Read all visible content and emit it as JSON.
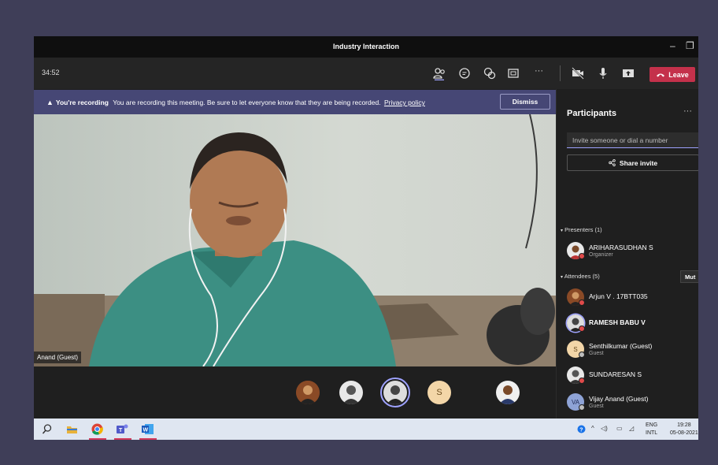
{
  "window": {
    "title": "Industry Interaction",
    "minimize": "–",
    "restore": "❐"
  },
  "toolbar": {
    "timer": "34:52",
    "leave_label": "Leave",
    "more": "···"
  },
  "banner": {
    "bold": "You're recording",
    "message": "You are recording this meeting. Be sure to let everyone know that they are being recorded.",
    "link": "Privacy policy",
    "dismiss": "Dismiss"
  },
  "video": {
    "name_tag": "Anand (Guest)"
  },
  "strip": {
    "letter_avatar": "S"
  },
  "participants": {
    "title": "Participants",
    "more": "···",
    "invite_placeholder": "Invite someone or dial a number",
    "share_invite": "Share invite",
    "presenters_label": "Presenters (1)",
    "attendees_label": "Attendees (5)",
    "mute_label": "Mut",
    "presenters": [
      {
        "name": "ARIHARASUDHAN S",
        "sub": "Organizer"
      }
    ],
    "attendees": [
      {
        "name": "Arjun V . 17BTT035",
        "sub": ""
      },
      {
        "name": "RAMESH BABU V",
        "sub": ""
      },
      {
        "name": "Senthilkumar (Guest)",
        "sub": "Guest",
        "initial": "S"
      },
      {
        "name": "SUNDARESAN S",
        "sub": ""
      },
      {
        "name": "Vijay Anand (Guest)",
        "sub": "Guest",
        "initial": "VA"
      }
    ]
  },
  "taskbar": {
    "lang_top": "ENG",
    "lang_bottom": "INTL",
    "time": "19:28",
    "date": "05-08-2021"
  },
  "colors": {
    "accent": "#464775",
    "leave": "#c4314b",
    "highlight": "#9ea2ff"
  }
}
